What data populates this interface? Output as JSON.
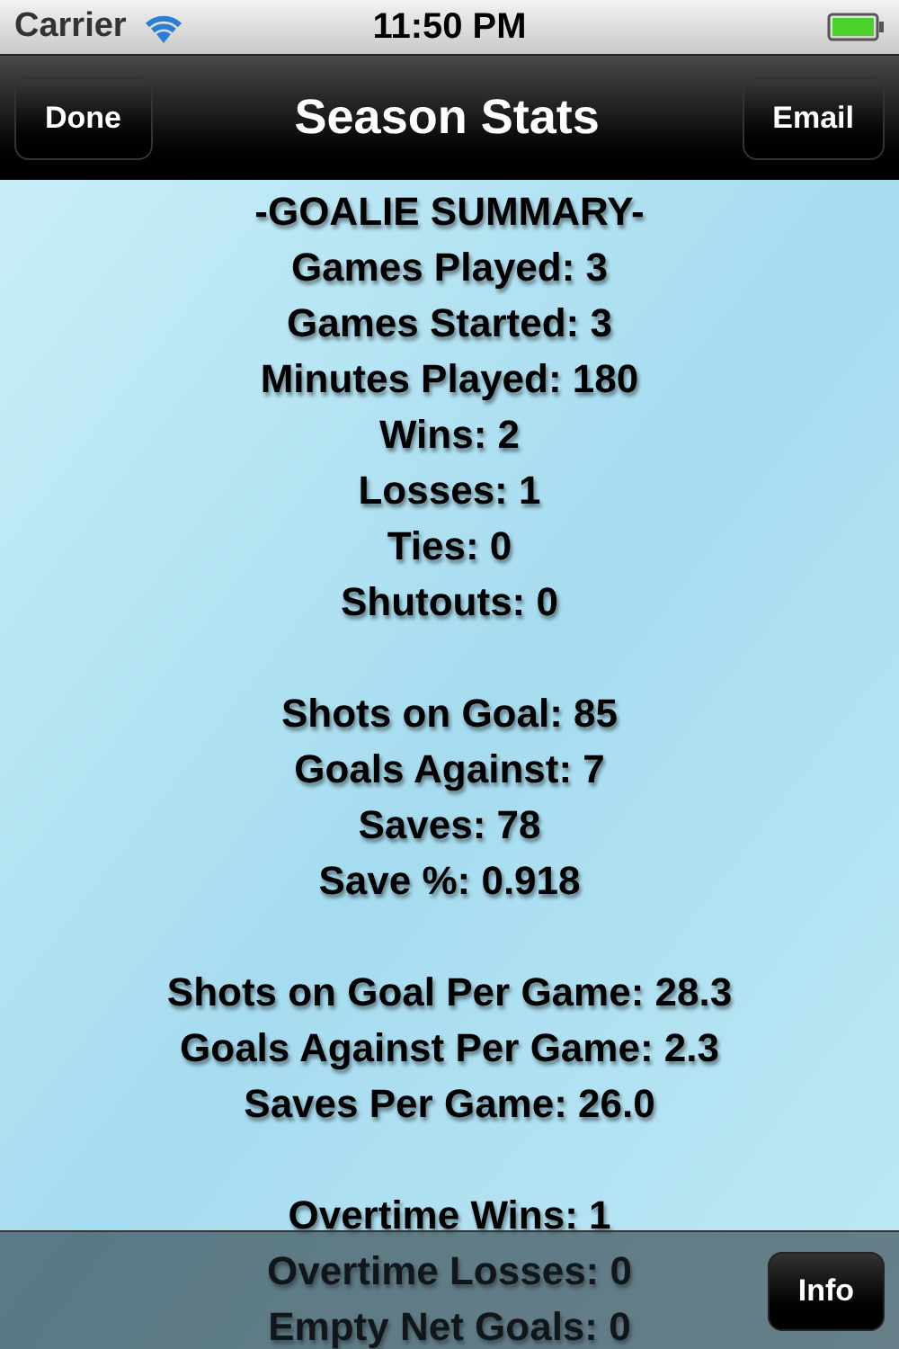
{
  "status_bar": {
    "carrier": "Carrier",
    "time": "11:50 PM"
  },
  "nav_bar": {
    "title": "Season Stats",
    "left_button": "Done",
    "right_button": "Email"
  },
  "stat_groups": [
    {
      "lines": [
        "-GOALIE SUMMARY-",
        "Games Played: 3",
        "Games Started: 3",
        "Minutes Played: 180",
        "Wins: 2",
        "Losses: 1",
        "Ties: 0",
        "Shutouts: 0"
      ]
    },
    {
      "lines": [
        "Shots on Goal: 85",
        "Goals Against: 7",
        "Saves: 78",
        "Save %: 0.918"
      ]
    },
    {
      "lines": [
        "Shots on Goal Per Game: 28.3",
        "Goals Against Per Game: 2.3",
        "Saves Per Game: 26.0"
      ]
    },
    {
      "lines": [
        "Overtime Wins: 1",
        "Overtime Losses: 0",
        "Empty Net Goals: 0"
      ]
    }
  ],
  "toolbar": {
    "button": "Info"
  }
}
